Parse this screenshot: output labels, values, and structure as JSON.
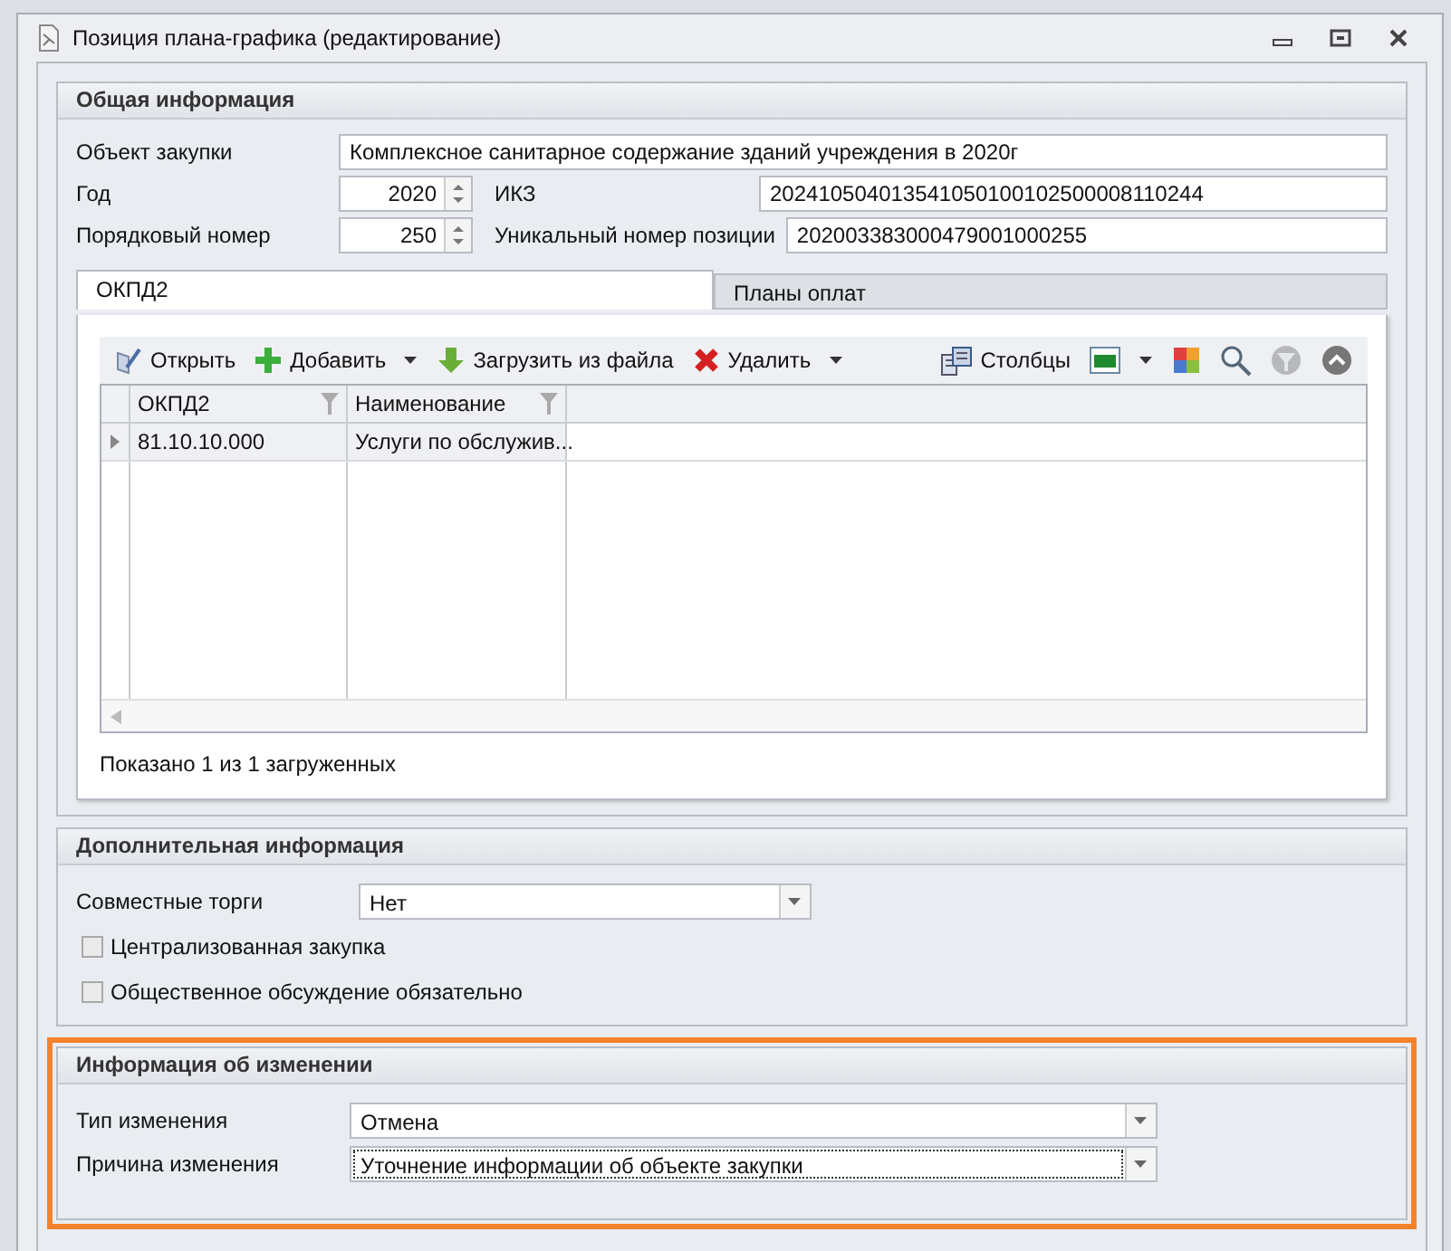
{
  "window": {
    "title": "Позиция плана-графика (редактирование)"
  },
  "general": {
    "title": "Общая информация",
    "purchase_object": {
      "label": "Объект закупки",
      "value": "Комплексное санитарное содержание зданий учреждения  в 2020г"
    },
    "year": {
      "label": "Год",
      "value": "2020"
    },
    "ikz": {
      "label": "ИКЗ",
      "value": "202410504013541050100102500008110244"
    },
    "order_number": {
      "label": "Порядковый номер",
      "value": "250"
    },
    "unique_number": {
      "label": "Уникальный номер позиции",
      "value": "202003383000479001000255"
    }
  },
  "tabs": [
    {
      "label": "ОКПД2",
      "selected": true
    },
    {
      "label": "Планы оплат",
      "selected": false
    }
  ],
  "toolbar": [
    {
      "kind": "button",
      "label": "Открыть"
    },
    {
      "kind": "button",
      "label": "Добавить"
    },
    {
      "kind": "dropdown"
    },
    {
      "kind": "button",
      "label": "Загрузить из файла"
    },
    {
      "kind": "button",
      "label": "Удалить"
    },
    {
      "kind": "dropdown"
    },
    {
      "kind": "spacer"
    },
    {
      "kind": "button",
      "label": "Столбцы"
    },
    {
      "kind": "icon",
      "disabled": false
    },
    {
      "kind": "dropdown"
    },
    {
      "kind": "icon",
      "disabled": false
    },
    {
      "kind": "icon",
      "disabled": false
    },
    {
      "kind": "icon",
      "disabled": true
    },
    {
      "kind": "icon",
      "disabled": false
    }
  ],
  "grid": {
    "columns": [
      {
        "label": "ОКПД2"
      },
      {
        "label": "Наименование"
      }
    ],
    "rows": [
      {
        "current": true,
        "cells": [
          "81.10.10.000",
          "Услуги по обслужив..."
        ]
      }
    ],
    "status": "Показано 1 из 1 загруженных"
  },
  "extra": {
    "title": "Дополнительная информация",
    "joint": {
      "label": "Совместные торги",
      "value": "Нет"
    },
    "checkboxes": [
      {
        "label": "Централизованная закупка",
        "checked": false
      },
      {
        "label": "Общественное обсуждение обязательно",
        "checked": false
      }
    ]
  },
  "change": {
    "title": "Информация об изменении",
    "highlighted": true,
    "fields": [
      {
        "label": "Тип изменения",
        "value": "Отмена",
        "focused": false
      },
      {
        "label": "Причина изменения",
        "value": "Уточнение информации об объекте закупки",
        "focused": true
      }
    ]
  }
}
